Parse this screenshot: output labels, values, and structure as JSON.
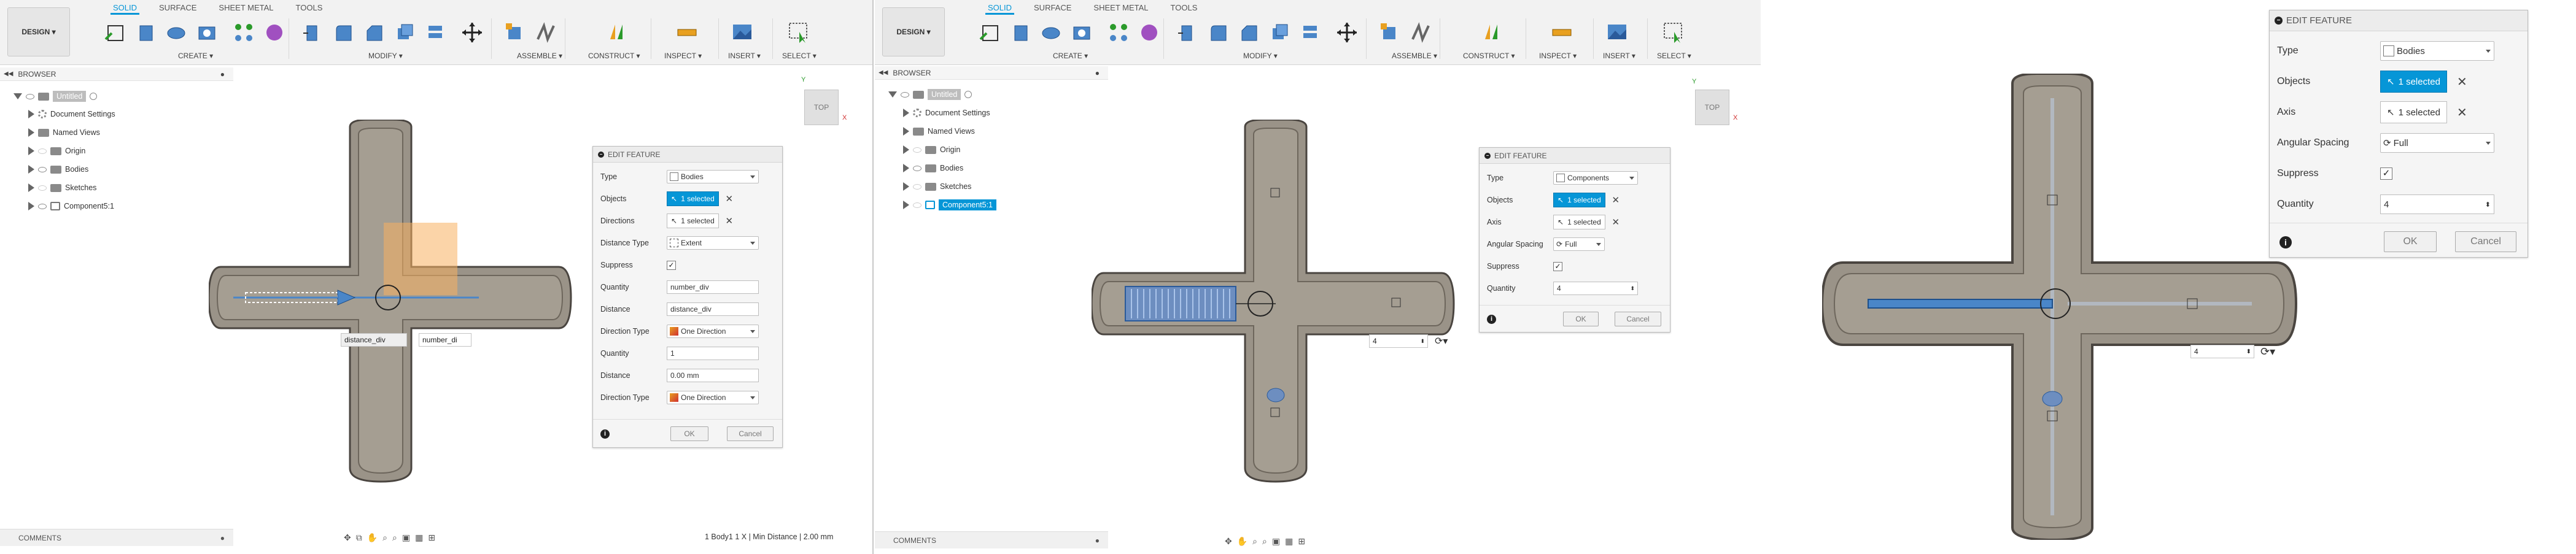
{
  "toolbar": {
    "workspace": "DESIGN",
    "tabs": [
      "SOLID",
      "SURFACE",
      "SHEET METAL",
      "TOOLS"
    ],
    "groups": [
      "CREATE",
      "MODIFY",
      "ASSEMBLE",
      "CONSTRUCT",
      "INSPECT",
      "INSERT",
      "SELECT"
    ]
  },
  "browser": {
    "title": "BROWSER",
    "root": "Untitled",
    "items_p1": [
      "Document Settings",
      "Named Views",
      "Origin",
      "Bodies",
      "Sketches",
      "Component5:1"
    ],
    "items_p2": [
      "Document Settings",
      "Named Views",
      "Origin",
      "Bodies",
      "Sketches",
      "Component5:1"
    ]
  },
  "viewcube": {
    "label": "TOP",
    "axis_x": "X",
    "axis_y": "Y"
  },
  "dialog1": {
    "title": "EDIT FEATURE",
    "rows": [
      {
        "label": "Type",
        "value": "Bodies"
      },
      {
        "label": "Objects",
        "value": "1 selected"
      },
      {
        "label": "Directions",
        "value": "1 selected"
      },
      {
        "label": "Distance Type",
        "value": "Extent"
      },
      {
        "label": "Suppress",
        "value": "✓"
      },
      {
        "label": "Quantity",
        "value": "number_div"
      },
      {
        "label": "Distance",
        "value": "distance_div"
      },
      {
        "label": "Direction Type",
        "value": "One Direction"
      },
      {
        "label": "Quantity",
        "value": "1"
      },
      {
        "label": "Distance",
        "value": "0.00 mm"
      },
      {
        "label": "Direction Type",
        "value": "One Direction"
      }
    ],
    "ok": "OK",
    "cancel": "Cancel"
  },
  "dialog2": {
    "title": "EDIT FEATURE",
    "rows": [
      {
        "label": "Type",
        "value": "Components"
      },
      {
        "label": "Objects",
        "value": "1 selected"
      },
      {
        "label": "Axis",
        "value": "1 selected"
      },
      {
        "label": "Angular Spacing",
        "value": "Full"
      },
      {
        "label": "Suppress",
        "value": "✓"
      },
      {
        "label": "Quantity",
        "value": "4"
      }
    ],
    "ok": "OK",
    "cancel": "Cancel"
  },
  "dialog3": {
    "title": "EDIT FEATURE",
    "rows": [
      {
        "label": "Type",
        "value": "Bodies"
      },
      {
        "label": "Objects",
        "value": "1 selected"
      },
      {
        "label": "Axis",
        "value": "1 selected"
      },
      {
        "label": "Angular Spacing",
        "value": "Full"
      },
      {
        "label": "Suppress",
        "value": "✓"
      },
      {
        "label": "Quantity",
        "value": "4"
      }
    ],
    "ok": "OK",
    "cancel": "Cancel"
  },
  "canvas1": {
    "distance_label": "distance_div",
    "number_label": "number_di"
  },
  "canvas2": {
    "quantity_value": "4"
  },
  "canvas3": {
    "quantity_value": "4"
  },
  "comments": "COMMENTS",
  "status_text": "1 Body1 1 X | Min Distance | 2.00 mm",
  "colors": {
    "accent": "#0696d7",
    "body_fill": "#9a9388",
    "body_stroke": "#4a4540",
    "highlight": "#4a86c8"
  }
}
